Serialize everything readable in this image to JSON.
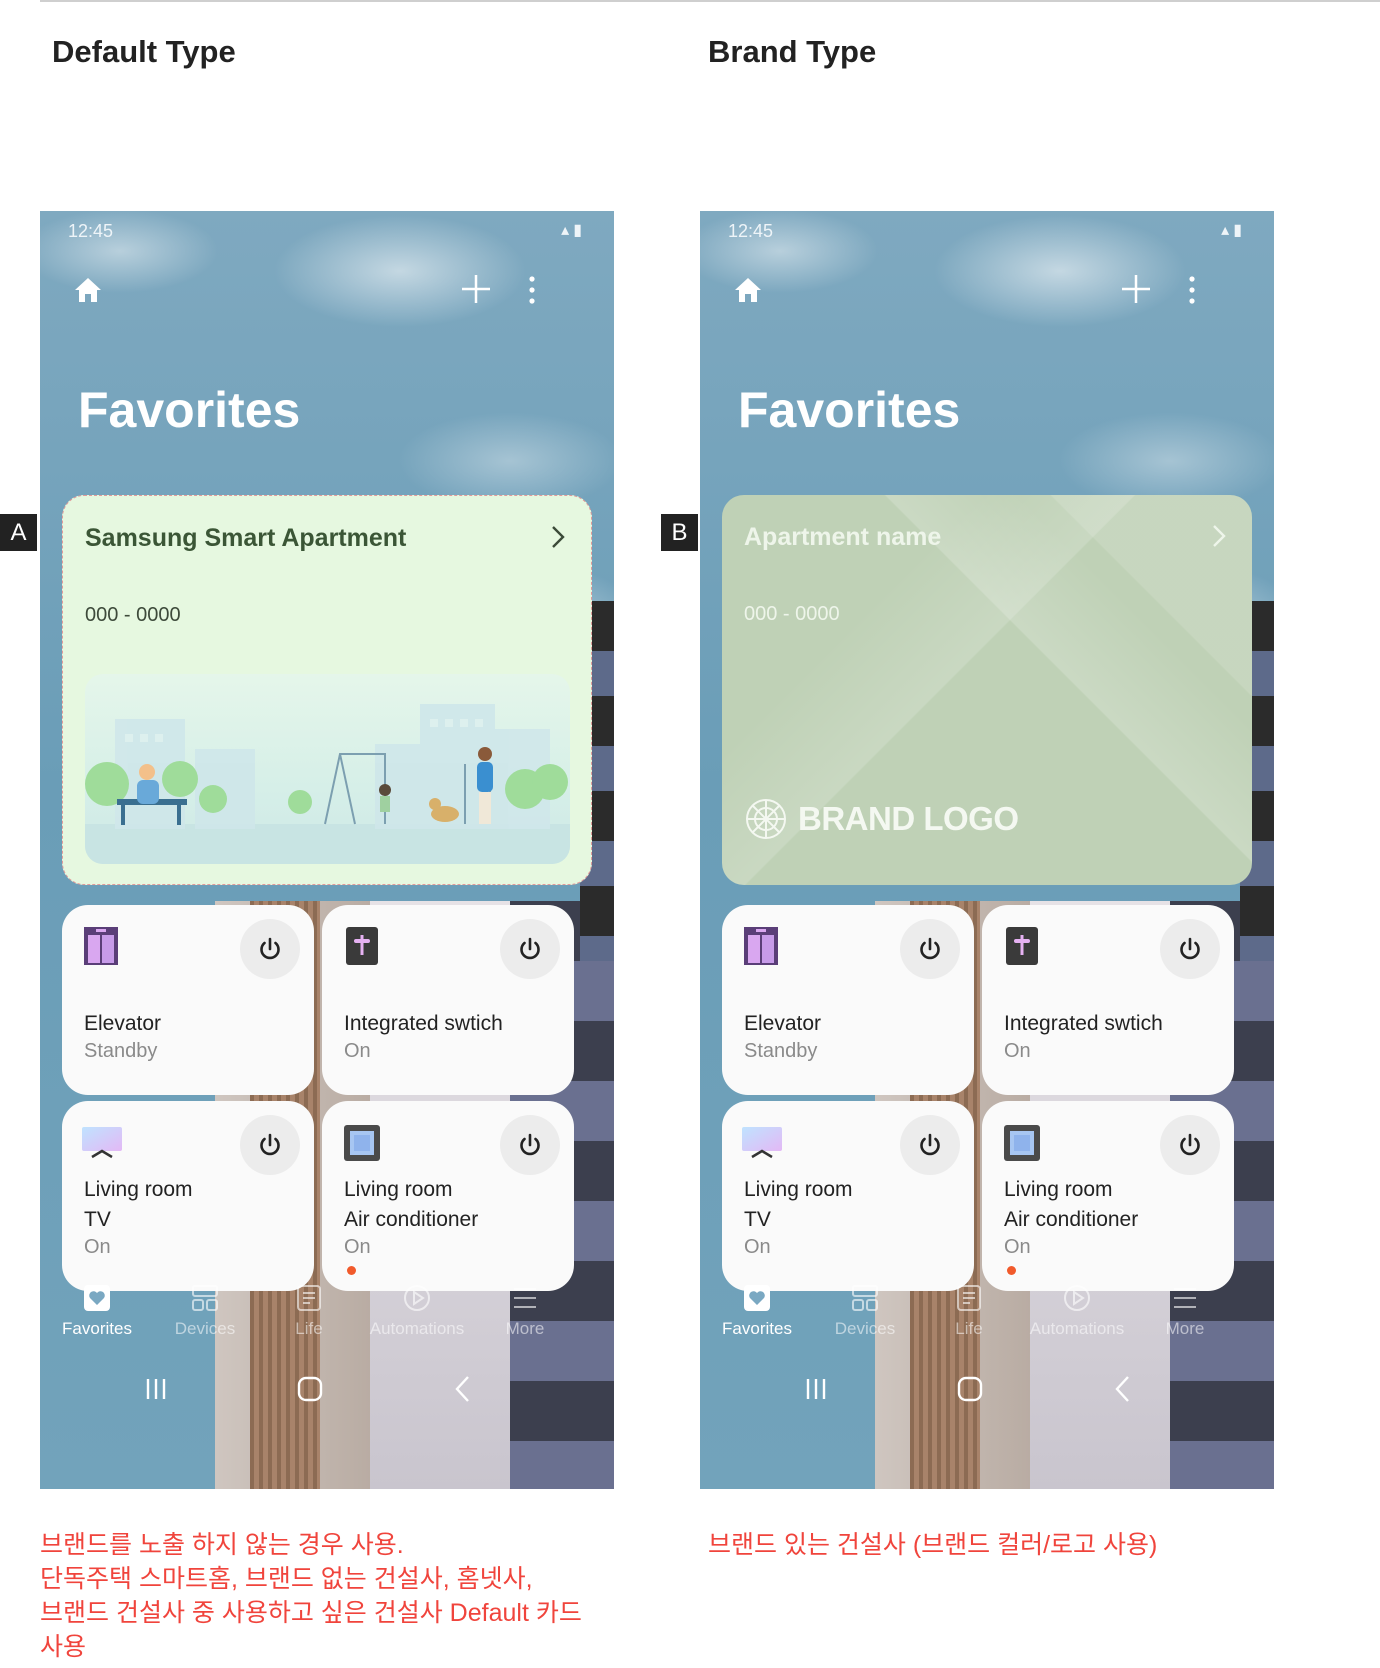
{
  "sections": {
    "default": {
      "title": "Default Type",
      "marker": "A",
      "note_lines": [
        "브랜드를 노출 하지 않는 경우 사용.",
        "단독주택 스마트홈, 브랜드 없는 건설사, 홈넷사,",
        "브랜드 건설사 중 사용하고 싶은 건설사 Default 카드",
        "사용"
      ]
    },
    "brand": {
      "title": "Brand Type",
      "marker": "B",
      "note_lines": [
        "브랜드 있는 건설사 (브랜드 컬러/로고 사용)"
      ]
    }
  },
  "phone_default": {
    "status_time": "12:45",
    "page_title": "Favorites",
    "hero": {
      "name": "Samsung Smart Apartment",
      "phone": "000 - 0000"
    },
    "tiles": [
      {
        "name": "Elevator",
        "state": "Standby",
        "icon": "elevator-icon"
      },
      {
        "name": "Integrated swtich",
        "state": "On",
        "icon": "switch-icon"
      },
      {
        "name": "Living room",
        "name2": "TV",
        "state": "On",
        "icon": "tv-icon"
      },
      {
        "name": "Living room",
        "name2": "Air conditioner",
        "state": "On",
        "icon": "air-conditioner-icon"
      }
    ],
    "nav": [
      "Favorites",
      "Devices",
      "Life",
      "Automations",
      "More"
    ]
  },
  "phone_brand": {
    "status_time": "12:45",
    "page_title": "Favorites",
    "hero": {
      "name": "Apartment name",
      "phone": "000 - 0000",
      "logo_text": "BRAND LOGO"
    },
    "tiles": [
      {
        "name": "Elevator",
        "state": "Standby",
        "icon": "elevator-icon"
      },
      {
        "name": "Integrated swtich",
        "state": "On",
        "icon": "switch-icon"
      },
      {
        "name": "Living room",
        "name2": "TV",
        "state": "On",
        "icon": "tv-icon"
      },
      {
        "name": "Living room",
        "name2": "Air conditioner",
        "state": "On",
        "icon": "air-conditioner-icon"
      }
    ],
    "nav": [
      "Favorites",
      "Devices",
      "Life",
      "Automations",
      "More"
    ]
  },
  "colors": {
    "default_card": "#e6f8e0",
    "brand_card": "#bfd1b6",
    "note_text": "#f0443c",
    "notification_dot": "#f15a2b"
  }
}
